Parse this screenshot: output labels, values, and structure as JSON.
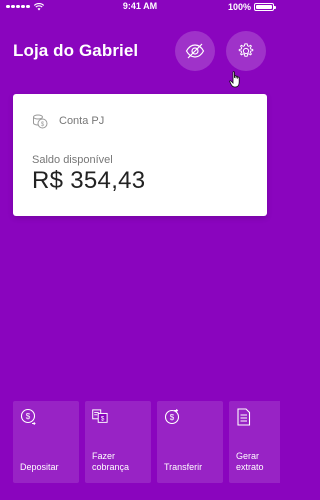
{
  "status_bar": {
    "time": "9:41 AM",
    "battery": "100%",
    "signal_icon": "signal-dots-icon",
    "wifi_icon": "wifi-icon",
    "battery_icon": "battery-icon"
  },
  "header": {
    "title": "Loja do Gabriel",
    "hide_button_icon": "eye-off-icon",
    "settings_button_icon": "gear-icon"
  },
  "account_card": {
    "account_label": "Conta PJ",
    "account_icon": "coins-icon",
    "balance_label": "Saldo disponível",
    "balance_value": "R$ 354,43"
  },
  "shortcuts": [
    {
      "label": "Depositar",
      "icon": "dollar-in-icon"
    },
    {
      "label": "Fazer\ncobrança",
      "icon": "invoice-dollar-icon"
    },
    {
      "label": "Transferir",
      "icon": "dollar-out-icon"
    },
    {
      "label": "Gerar\nextrato",
      "icon": "document-icon"
    }
  ],
  "colors": {
    "background": "#8A05BE",
    "card": "#FFFFFF",
    "text_primary": "#FFFFFF"
  }
}
